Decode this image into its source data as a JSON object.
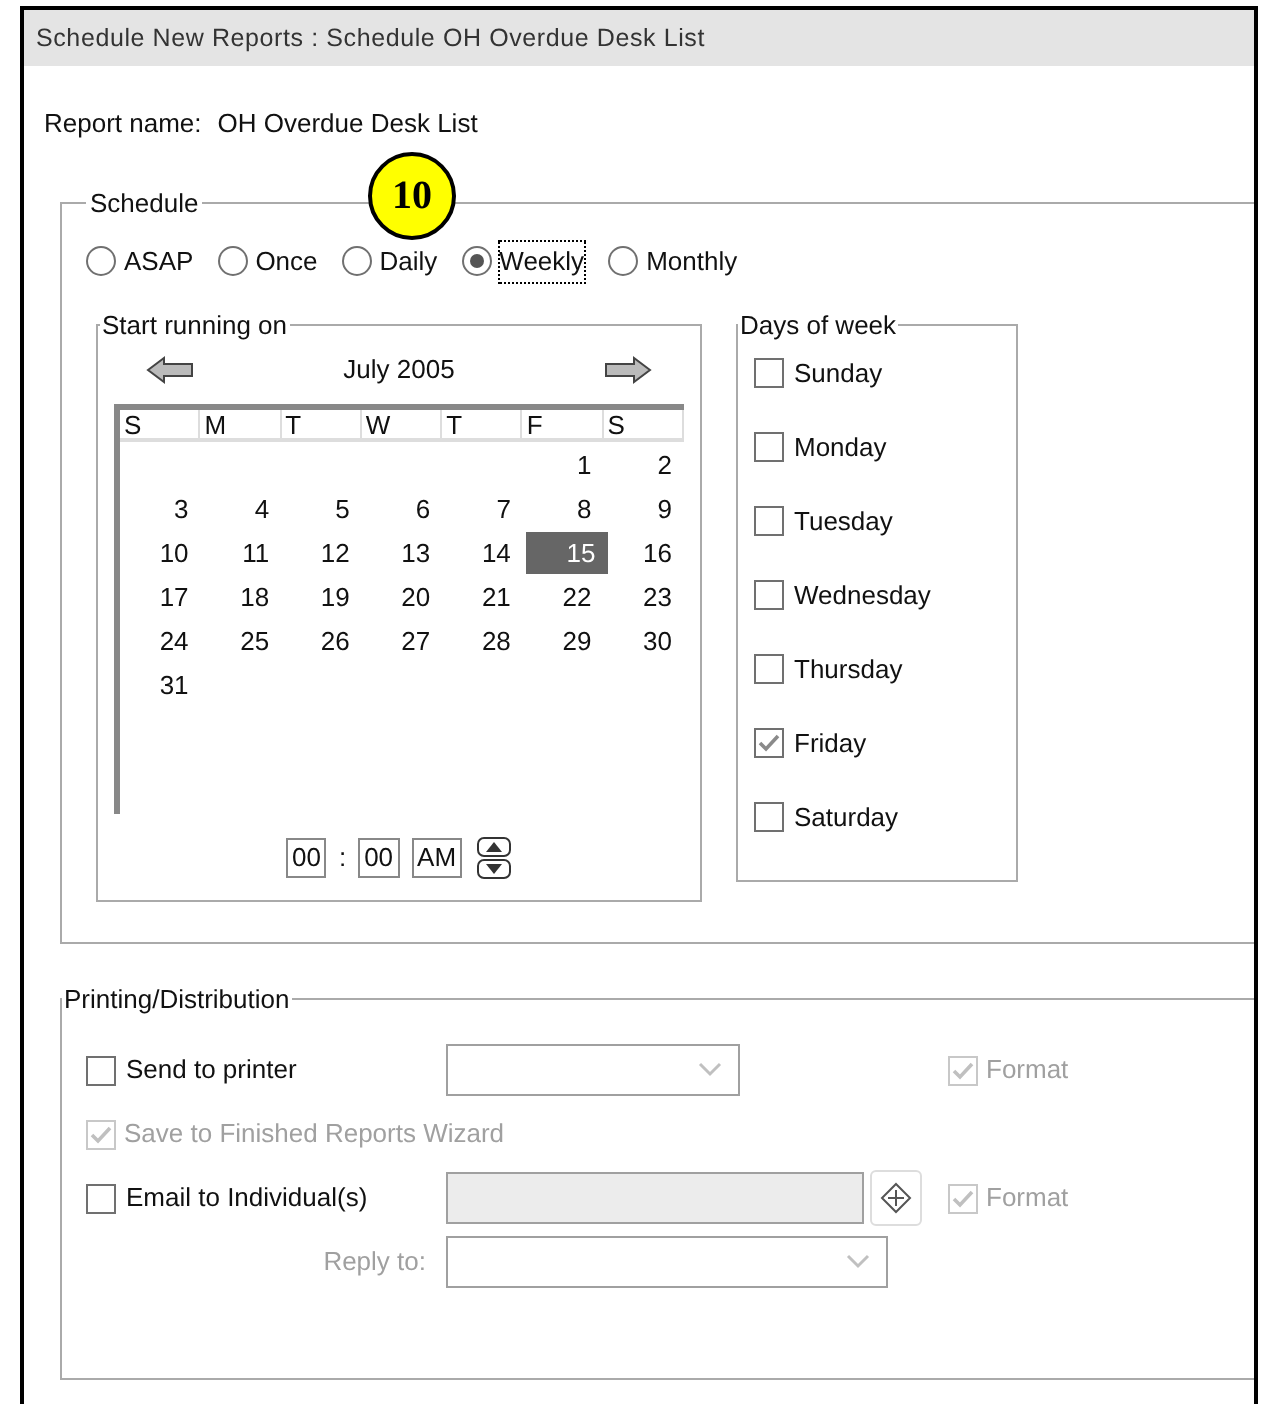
{
  "window": {
    "title": "Schedule New Reports : Schedule OH Overdue Desk List"
  },
  "report_name": {
    "label": "Report name:",
    "value": "OH Overdue Desk List"
  },
  "callout": "10",
  "schedule": {
    "legend": "Schedule",
    "frequencies": [
      {
        "label": "ASAP",
        "selected": false
      },
      {
        "label": "Once",
        "selected": false
      },
      {
        "label": "Daily",
        "selected": false
      },
      {
        "label": "Weekly",
        "selected": true
      },
      {
        "label": "Monthly",
        "selected": false
      }
    ],
    "start": {
      "legend": "Start running on",
      "month": "July 2005",
      "weekday_headers": [
        "S",
        "M",
        "T",
        "W",
        "T",
        "F",
        "S"
      ],
      "weeks": [
        {
          "kind": "first",
          "days": [
            {
              "day": "1",
              "selected": false
            },
            {
              "day": "2",
              "selected": false
            }
          ]
        },
        {
          "kind": "full",
          "days": [
            {
              "day": "3",
              "selected": false
            },
            {
              "day": "4",
              "selected": false
            },
            {
              "day": "5",
              "selected": false
            },
            {
              "day": "6",
              "selected": false
            },
            {
              "day": "7",
              "selected": false
            },
            {
              "day": "8",
              "selected": false
            },
            {
              "day": "9",
              "selected": false
            }
          ]
        },
        {
          "kind": "full",
          "days": [
            {
              "day": "10",
              "selected": false
            },
            {
              "day": "11",
              "selected": false
            },
            {
              "day": "12",
              "selected": false
            },
            {
              "day": "13",
              "selected": false
            },
            {
              "day": "14",
              "selected": false
            },
            {
              "day": "15",
              "selected": true
            },
            {
              "day": "16",
              "selected": false
            }
          ]
        },
        {
          "kind": "full",
          "days": [
            {
              "day": "17",
              "selected": false
            },
            {
              "day": "18",
              "selected": false
            },
            {
              "day": "19",
              "selected": false
            },
            {
              "day": "20",
              "selected": false
            },
            {
              "day": "21",
              "selected": false
            },
            {
              "day": "22",
              "selected": false
            },
            {
              "day": "23",
              "selected": false
            }
          ]
        },
        {
          "kind": "full",
          "days": [
            {
              "day": "24",
              "selected": false
            },
            {
              "day": "25",
              "selected": false
            },
            {
              "day": "26",
              "selected": false
            },
            {
              "day": "27",
              "selected": false
            },
            {
              "day": "28",
              "selected": false
            },
            {
              "day": "29",
              "selected": false
            },
            {
              "day": "30",
              "selected": false
            }
          ]
        },
        {
          "kind": "last",
          "days": [
            {
              "day": "31",
              "selected": false
            }
          ]
        }
      ],
      "time": {
        "hour": "00",
        "separator": ":",
        "minute": "00",
        "period": "AM"
      }
    },
    "days": {
      "legend": "Days of week",
      "items": [
        {
          "label": "Sunday",
          "checked": false
        },
        {
          "label": "Monday",
          "checked": false
        },
        {
          "label": "Tuesday",
          "checked": false
        },
        {
          "label": "Wednesday",
          "checked": false
        },
        {
          "label": "Thursday",
          "checked": false
        },
        {
          "label": "Friday",
          "checked": true
        },
        {
          "label": "Saturday",
          "checked": false
        }
      ]
    }
  },
  "printing": {
    "legend": "Printing/Distribution",
    "send_to_printer": {
      "label": "Send to printer",
      "checked": false,
      "format": {
        "label": "Format",
        "checked": true,
        "disabled": true
      }
    },
    "save_finished": {
      "label": "Save to Finished Reports Wizard",
      "checked": true,
      "disabled": true
    },
    "email": {
      "label": "Email to Individual(s)",
      "checked": false,
      "field_disabled": true,
      "format": {
        "label": "Format",
        "checked": true,
        "disabled": true
      }
    },
    "reply_to": {
      "label": "Reply to:",
      "disabled": true
    }
  }
}
